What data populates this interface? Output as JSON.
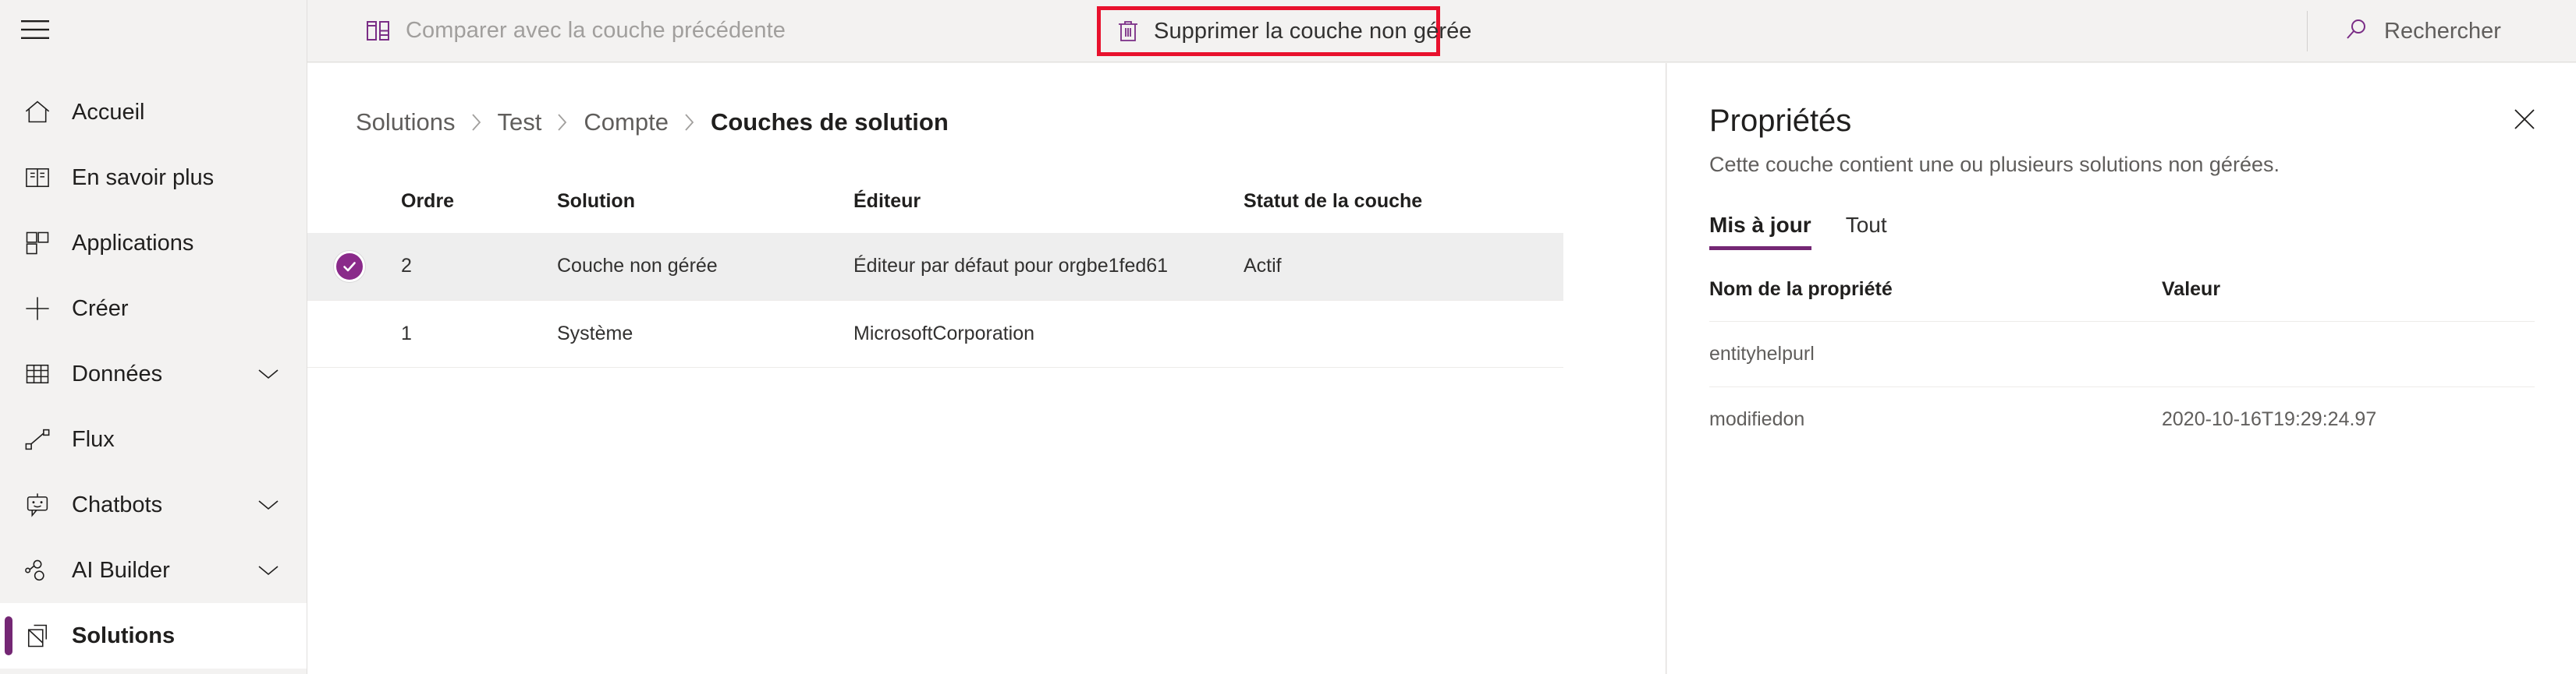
{
  "commandbar": {
    "compare_label": "Comparer avec la couche précédente",
    "compare_icon": "compare-layers-icon",
    "delete_label": "Supprimer la couche non gérée",
    "delete_icon": "trash-icon",
    "highlight_color": "#e8112d",
    "accent_color": "#742774"
  },
  "search": {
    "placeholder": "Rechercher",
    "icon": "search-icon"
  },
  "sidebar": {
    "menu_icon": "hamburger-menu-icon",
    "items": [
      {
        "label": "Accueil",
        "icon": "home-icon",
        "expandable": false,
        "selected": false
      },
      {
        "label": "En savoir plus",
        "icon": "book-icon",
        "expandable": false,
        "selected": false
      },
      {
        "label": "Applications",
        "icon": "apps-grid-icon",
        "expandable": false,
        "selected": false
      },
      {
        "label": "Créer",
        "icon": "plus-icon",
        "expandable": false,
        "selected": false
      },
      {
        "label": "Données",
        "icon": "table-icon",
        "expandable": true,
        "selected": false
      },
      {
        "label": "Flux",
        "icon": "flow-icon",
        "expandable": false,
        "selected": false
      },
      {
        "label": "Chatbots",
        "icon": "chatbot-icon",
        "expandable": true,
        "selected": false
      },
      {
        "label": "AI Builder",
        "icon": "ai-builder-icon",
        "expandable": true,
        "selected": false
      },
      {
        "label": "Solutions",
        "icon": "solutions-icon",
        "expandable": false,
        "selected": true
      }
    ]
  },
  "main": {
    "breadcrumb": [
      {
        "label": "Solutions",
        "current": false
      },
      {
        "label": "Test",
        "current": false
      },
      {
        "label": "Compte",
        "current": false
      },
      {
        "label": "Couches de solution",
        "current": true
      }
    ],
    "table": {
      "columns": [
        "Ordre",
        "Solution",
        "Éditeur",
        "Statut de la couche"
      ],
      "rows": [
        {
          "selected": true,
          "order": "2",
          "solution": "Couche non gérée",
          "editor": "Éditeur par défaut pour orgbe1fed61",
          "status": "Actif"
        },
        {
          "selected": false,
          "order": "1",
          "solution": "Système",
          "editor": "MicrosoftCorporation",
          "status": ""
        }
      ]
    }
  },
  "panel": {
    "title": "Propriétés",
    "subtitle": "Cette couche contient une ou plusieurs solutions non gérées.",
    "close_icon": "close-icon",
    "tabs": [
      {
        "label": "Mis à jour",
        "active": true
      },
      {
        "label": "Tout",
        "active": false
      }
    ],
    "table": {
      "columns": [
        "Nom de la propriété",
        "Valeur"
      ],
      "rows": [
        {
          "name": "entityhelpurl",
          "value": ""
        },
        {
          "name": "modifiedon",
          "value": "2020-10-16T19:29:24.97"
        }
      ]
    }
  }
}
